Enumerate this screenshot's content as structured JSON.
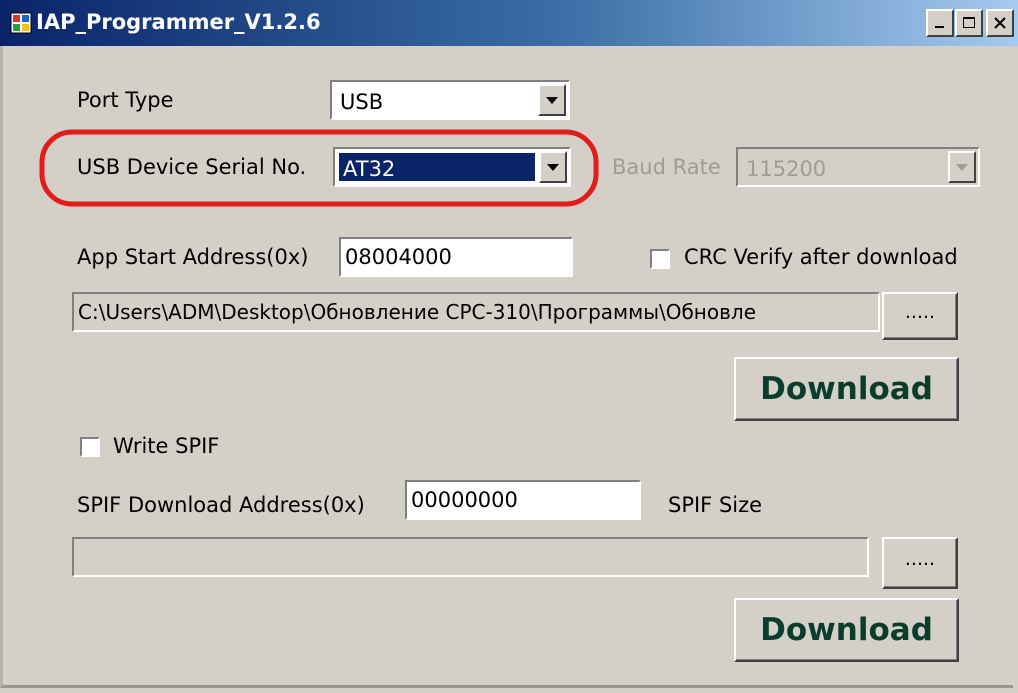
{
  "window": {
    "title": "IAP_Programmer_V1.2.6",
    "controls": {
      "minimize": "_",
      "maximize": "□",
      "close": "X"
    }
  },
  "port_type": {
    "label": "Port Type",
    "value": "USB"
  },
  "usb_serial": {
    "label": "USB Device Serial No.",
    "value": "AT32"
  },
  "baud_rate": {
    "label": "Baud Rate",
    "value": "115200",
    "enabled": false
  },
  "app_start": {
    "label": "App Start Address(0x)",
    "value": "08004000"
  },
  "crc_verify": {
    "label": "CRC Verify after download",
    "checked": false
  },
  "file_path": {
    "value": "C:\\Users\\ADM\\Desktop\\Обновление CPC-310\\Программы\\Обновле"
  },
  "browse_button": {
    "label": "....."
  },
  "download_button": {
    "label": "Download"
  },
  "write_spif": {
    "label": "Write SPIF",
    "checked": false
  },
  "spif": {
    "address_label": "SPIF Download Address(0x)",
    "address_value": "00000000",
    "size_label": "SPIF Size",
    "file_path": "",
    "browse_label": ".....",
    "download_label": "Download"
  },
  "annotation": {
    "color": "#e21b1b",
    "shape": "ellipse"
  }
}
